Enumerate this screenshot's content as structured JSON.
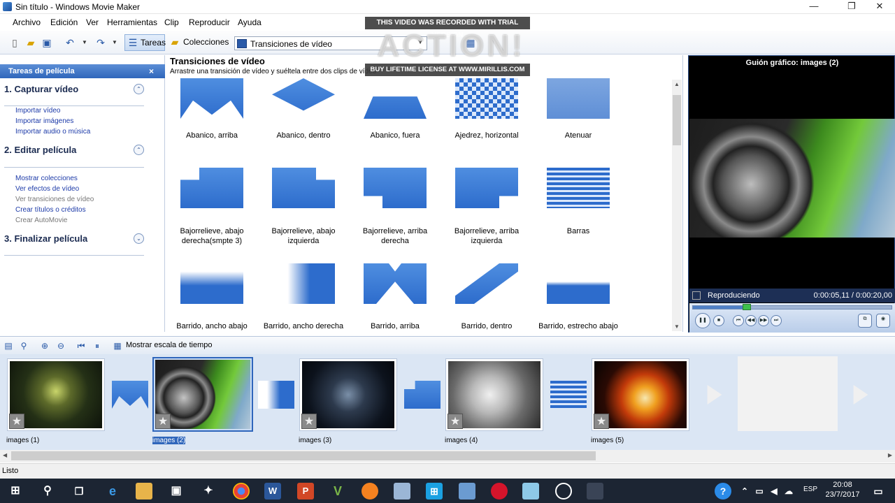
{
  "window": {
    "title": "Sin título - Windows Movie Maker",
    "min": "—",
    "max": "❐",
    "close": "✕"
  },
  "menu": [
    "Archivo",
    "Edición",
    "Ver",
    "Herramientas",
    "Clip",
    "Reproducir",
    "Ayuda"
  ],
  "toolbar": {
    "tareas_label": "Tareas",
    "colecciones_label": "Colecciones",
    "combo_value": "Transiciones de vídeo"
  },
  "watermark": {
    "top": "THIS VIDEO WAS RECORDED WITH TRIAL VERSION",
    "logo": "ACTION!",
    "bottom": "BUY LIFETIME LICENSE AT WWW.MIRILLIS.COM"
  },
  "taskpane": {
    "header": "Tareas de película",
    "close": "×",
    "sections": [
      {
        "title": "1. Capturar vídeo",
        "toggle": "⌃",
        "links": [
          {
            "label": "Importar vídeo",
            "enabled": true
          },
          {
            "label": "Importar imágenes",
            "enabled": true
          },
          {
            "label": "Importar audio o música",
            "enabled": true
          }
        ]
      },
      {
        "title": "2. Editar película",
        "toggle": "⌃",
        "links": [
          {
            "label": "Mostrar colecciones",
            "enabled": true
          },
          {
            "label": "Ver efectos de vídeo",
            "enabled": true
          },
          {
            "label": "Ver transiciones de vídeo",
            "enabled": false
          },
          {
            "label": "Crear títulos o créditos",
            "enabled": true
          },
          {
            "label": "Crear AutoMovie",
            "enabled": false
          }
        ]
      },
      {
        "title": "3. Finalizar película",
        "toggle": "⌄",
        "links": []
      }
    ]
  },
  "content": {
    "title": "Transiciones de vídeo",
    "subtitle": "Arrastre una transición de vídeo y suéltela entre dos clips de vídeo",
    "tiles": [
      [
        "Abanico, arriba",
        "Abanico, dentro",
        "Abanico, fuera",
        "Ajedrez, horizontal",
        "Atenuar"
      ],
      [
        "Bajorrelieve, abajo derecha(smpte 3)",
        "Bajorrelieve, abajo izquierda",
        "Bajorrelieve, arriba derecha",
        "Bajorrelieve, arriba izquierda",
        "Barras"
      ],
      [
        "Barrido, ancho abajo",
        "Barrido, ancho derecha",
        "Barrido, arriba",
        "Barrido, dentro",
        "Barrido, estrecho abajo"
      ]
    ]
  },
  "preview": {
    "title": "Guión gráfico: images (2)",
    "status": "Reproduciendo",
    "time": "0:00:05,11 / 0:00:20,00",
    "progress": 0.27
  },
  "storyboard_toolbar": {
    "label": "Mostrar escala de tiempo"
  },
  "storyboard": {
    "clips": [
      "images (1)",
      "images (2)",
      "images (3)",
      "images (4)",
      "images (5)"
    ],
    "selected": 1
  },
  "status": "Listo",
  "taskbar": {
    "time": "20:08",
    "date": "23/7/2017",
    "lang": "ESP"
  }
}
